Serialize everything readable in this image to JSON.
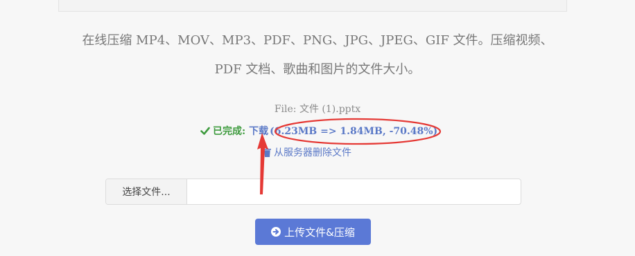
{
  "intro": {
    "line1": "在线压缩 MP4、MOV、MP3、PDF、PNG、JPG、JPEG、GIF 文件。压缩视频、",
    "line2": "PDF 文档、歌曲和图片的文件大小。"
  },
  "result": {
    "file_label": "File: 文件 (1).pptx",
    "status_label": "已完成:",
    "download_label": "下载",
    "size_info": "(6.23MB => 1.84MB, -70.48%)",
    "delete_label": "从服务器删除文件"
  },
  "upload": {
    "choose_label": "选择文件...",
    "file_value": "",
    "submit_label": "上传文件&压缩"
  },
  "colors": {
    "success": "#3e9b3e",
    "link": "#5b79c7",
    "primary": "#5b79d6",
    "annotation": "#e53935"
  },
  "icons": {
    "status": "check-icon",
    "delete": "trash-icon",
    "submit": "arrow-right-icon"
  }
}
